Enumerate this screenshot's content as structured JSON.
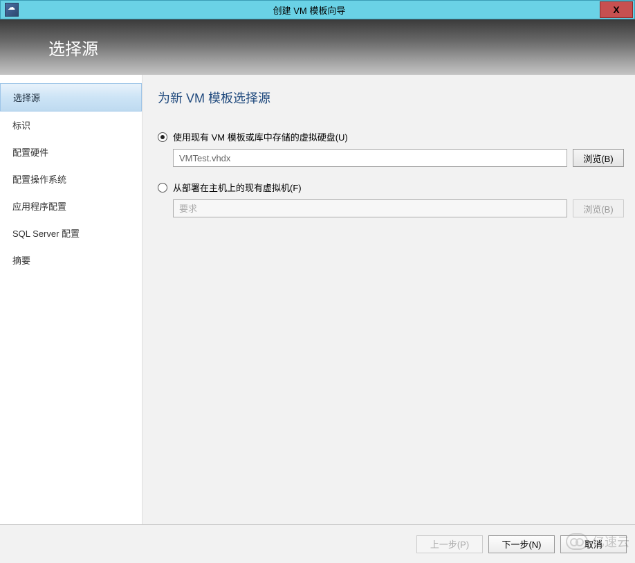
{
  "titlebar": {
    "title": "创建 VM 模板向导",
    "close": "X"
  },
  "header": {
    "title": "选择源"
  },
  "sidebar": {
    "items": [
      {
        "label": "选择源",
        "active": true
      },
      {
        "label": "标识",
        "active": false
      },
      {
        "label": "配置硬件",
        "active": false
      },
      {
        "label": "配置操作系统",
        "active": false
      },
      {
        "label": "应用程序配置",
        "active": false
      },
      {
        "label": "SQL Server 配置",
        "active": false
      },
      {
        "label": "摘要",
        "active": false
      }
    ]
  },
  "main": {
    "title": "为新 VM 模板选择源",
    "option1": {
      "label": "使用现有 VM 模板或库中存储的虚拟硬盘(U)",
      "value": "VMTest.vhdx",
      "browse": "浏览(B)",
      "selected": true
    },
    "option2": {
      "label": "从部署在主机上的现有虚拟机(F)",
      "placeholder": "要求",
      "browse": "浏览(B)",
      "selected": false
    }
  },
  "footer": {
    "previous": "上一步(P)",
    "next": "下一步(N)",
    "cancel": "取消"
  },
  "watermark": {
    "text": "亿速云"
  }
}
